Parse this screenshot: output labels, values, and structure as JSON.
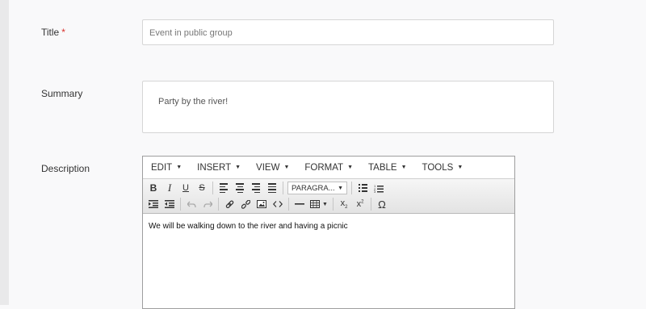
{
  "form": {
    "title": {
      "label": "Title",
      "required_mark": "*",
      "value": "Event in public group"
    },
    "summary": {
      "label": "Summary",
      "value": "Party by the river!"
    },
    "description": {
      "label": "Description"
    }
  },
  "editor": {
    "menus": [
      "EDIT",
      "INSERT",
      "VIEW",
      "FORMAT",
      "TABLE",
      "TOOLS"
    ],
    "toolbar": {
      "bold": "B",
      "italic": "I",
      "underline": "U",
      "strike": "S",
      "format_select": "PARAGRA...",
      "special_char": "Ω"
    },
    "content": "We will be walking down to the river and having a picnic"
  },
  "colors": {
    "required": "#d9302b",
    "border": "#d6d6d6",
    "background": "#f9f9fa"
  }
}
